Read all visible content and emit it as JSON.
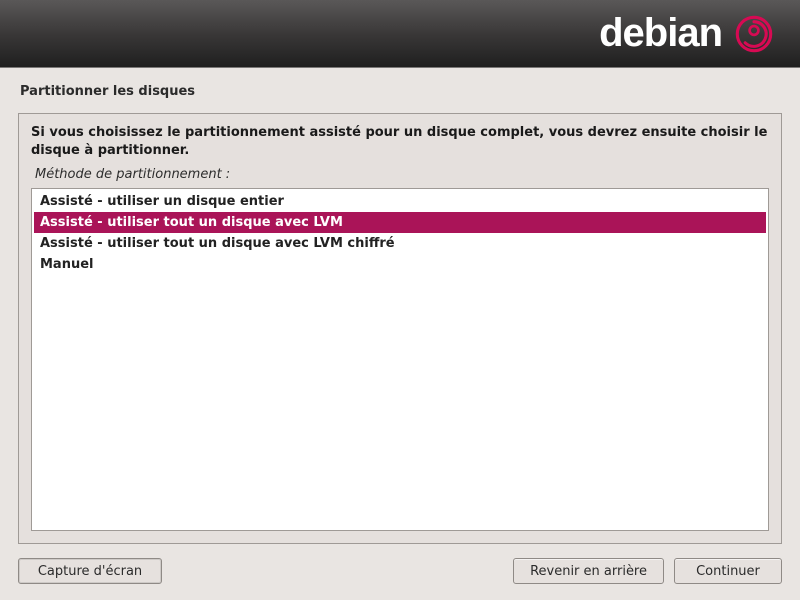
{
  "brand": "debian",
  "page_title": "Partitionner les disques",
  "instruction": "Si vous choisissez le partitionnement assisté pour un disque complet, vous devrez ensuite choisir le disque à partitionner.",
  "method_label": "Méthode de partitionnement :",
  "options": [
    {
      "label": "Assisté - utiliser un disque entier",
      "selected": false
    },
    {
      "label": "Assisté - utiliser tout un disque avec LVM",
      "selected": true
    },
    {
      "label": "Assisté - utiliser tout un disque avec LVM chiffré",
      "selected": false
    },
    {
      "label": "Manuel",
      "selected": false
    }
  ],
  "buttons": {
    "screenshot": "Capture d'écran",
    "back": "Revenir en arrière",
    "continue": "Continuer"
  }
}
